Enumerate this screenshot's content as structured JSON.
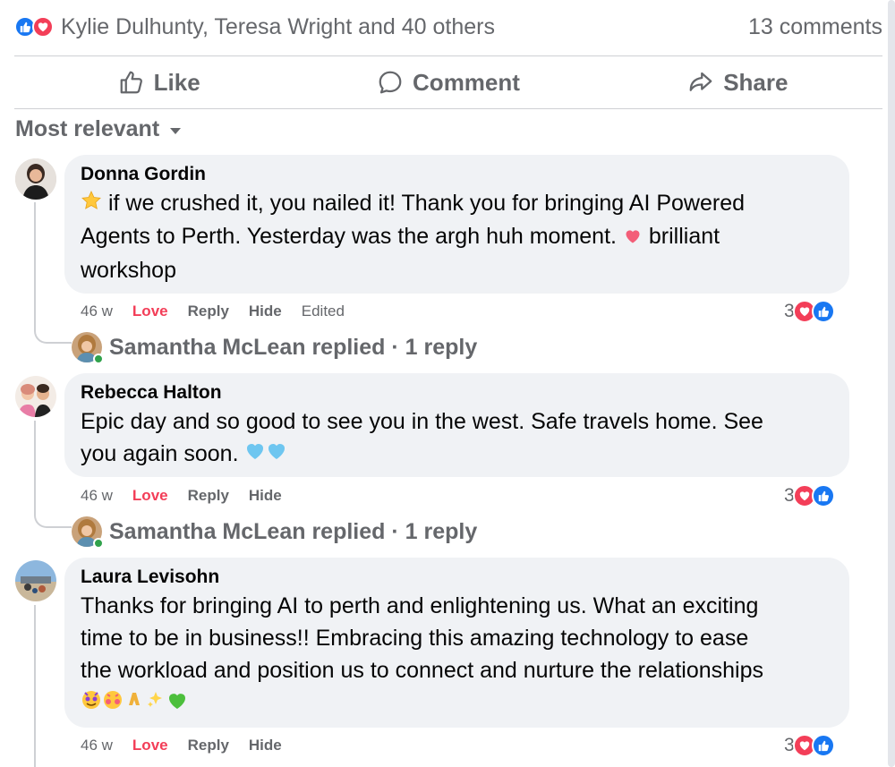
{
  "reactions_summary": {
    "names": "Kylie Dulhunty, Teresa Wright and 40 others",
    "comments": "13 comments"
  },
  "actions": {
    "like": "Like",
    "comment": "Comment",
    "share": "Share"
  },
  "sort": {
    "label": "Most relevant"
  },
  "comments": [
    {
      "author": "Donna Gordin",
      "text_1": "if we crushed it, you nailed it! Thank you for bringing AI Powered",
      "text_2": "Agents to Perth. Yesterday was the argh huh moment.",
      "text_2b": "brilliant",
      "text_3": "workshop",
      "time": "46 w",
      "love": "Love",
      "reply": "Reply",
      "hide": "Hide",
      "edited": "Edited",
      "reaction_count": "3",
      "replied_text": "Samantha McLean replied · 1 reply"
    },
    {
      "author": "Rebecca Halton",
      "text_1": "Epic day and so good to see you in the west. Safe travels home. See",
      "text_2": "you again soon.",
      "time": "46 w",
      "love": "Love",
      "reply": "Reply",
      "hide": "Hide",
      "reaction_count": "3",
      "replied_text": "Samantha McLean replied · 1 reply"
    },
    {
      "author": "Laura Levisohn",
      "text_1": "Thanks for bringing AI to perth and enlightening us. What an exciting",
      "text_2": "time to be in business!! Embracing this amazing technology to ease",
      "text_3": "the workload and position us to connect and nurture the relationships",
      "time": "46 w",
      "love": "Love",
      "reply": "Reply",
      "hide": "Hide",
      "reaction_count": "3"
    }
  ],
  "colors": {
    "like_blue": "#1877f2",
    "love_red": "#f33e58",
    "secondary_text": "#65676b",
    "bubble_bg": "#f0f2f5"
  }
}
